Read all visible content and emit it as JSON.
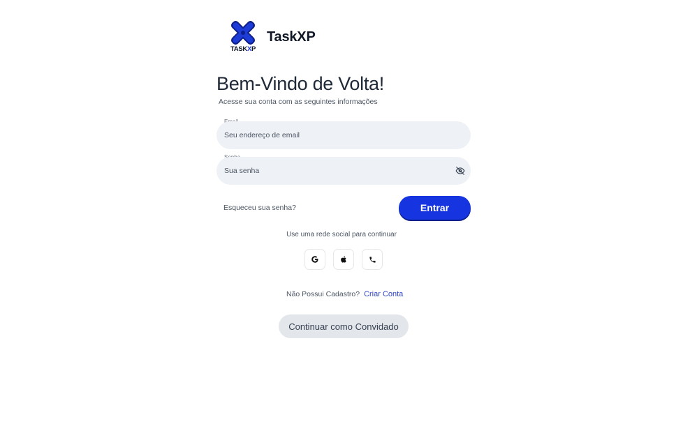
{
  "brand": {
    "name": "TaskXP",
    "logo_caption_prefix": "TASK",
    "logo_caption_highlight": "X",
    "logo_caption_suffix": "P",
    "accent_color": "#1d3bd6"
  },
  "header": {
    "title": "Bem-Vindo de Volta!",
    "subtitle": "Acesse sua conta com as seguintes informações"
  },
  "form": {
    "email": {
      "label": "Email",
      "placeholder": "Seu endereço de email",
      "value": ""
    },
    "password": {
      "label": "Senha",
      "placeholder": "Sua senha",
      "value": "",
      "toggle_icon": "eye-off-icon"
    },
    "forgot_label": "Esqueceu sua senha?",
    "submit_label": "Entrar",
    "submit_color": "#1634e0"
  },
  "social": {
    "prompt": "Use uma rede social para continuar",
    "providers": [
      {
        "name": "Google",
        "icon": "google-icon"
      },
      {
        "name": "Apple",
        "icon": "apple-icon"
      },
      {
        "name": "Phone",
        "icon": "phone-icon"
      }
    ]
  },
  "signup": {
    "question": "Não Possui Cadastro?",
    "link_label": "Criar Conta"
  },
  "guest": {
    "label": "Continuar como Convidado"
  }
}
